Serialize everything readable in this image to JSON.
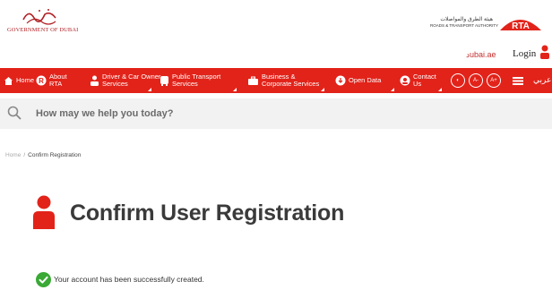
{
  "header": {
    "gov_logo_script": "حكومة دبي",
    "gov_logo_text": "GOVERNMENT OF DUBAI",
    "rta_arabic": "هيئة الطرق والمواصلات",
    "rta_english": "ROADS & TRANSPORT AUTHORITY",
    "rta_badge": "RTA",
    "dubai_link": "دubai.ae",
    "login_label": "Login"
  },
  "nav": {
    "home": "Home",
    "about": "About\nRTA",
    "driver": "Driver & Car Owner\nServices",
    "transport": "Public Transport\nServices",
    "business": "Business &\nCorporate Services",
    "open_data": "Open Data",
    "contact": "Contact\nUs",
    "contrast": "◐",
    "font_minus": "A-",
    "font_plus": "A+",
    "language": "عربي",
    "accent_color": "#e2231a"
  },
  "search": {
    "placeholder": "How may we help you today?"
  },
  "breadcrumb": {
    "home": "Home",
    "separator": "/",
    "current": "Confirm Registration"
  },
  "main": {
    "title": "Confirm User Registration",
    "success_message": "Your account has been successfully created."
  }
}
